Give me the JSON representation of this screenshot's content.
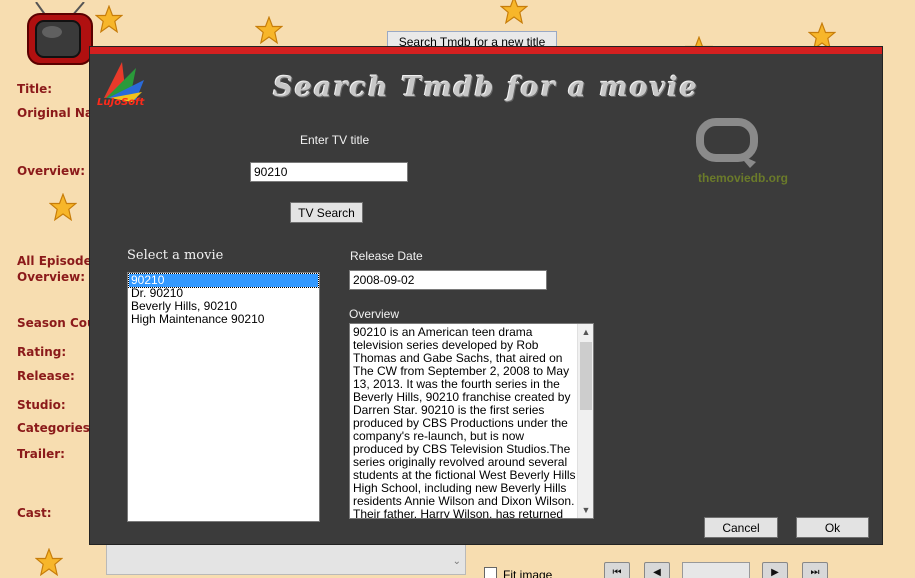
{
  "background_app": {
    "top_button_label": "Search Tmdb for a new title",
    "labels": {
      "title": "Title:",
      "original_name": "Original Nam",
      "overview": "Overview:",
      "all_episodes": "All Episodes",
      "all_episodes_overview": "Overview:",
      "season_count": "Season Count",
      "rating": "Rating:",
      "release": "Release:",
      "studio": "Studio:",
      "categories": "Categories:",
      "trailer": "Trailer:",
      "cast": "Cast:"
    },
    "fit_image_label": "Fit image",
    "label_color": "#8b1a1a",
    "bg_color": "#f7ddb0"
  },
  "dialog": {
    "title": "Search Tmdb for a movie",
    "logo_text": "LuJoSoft",
    "tmdb_logo_text": "themoviedb.org",
    "enter_title_label": "Enter TV title",
    "search_value": "90210",
    "search_button": "TV Search",
    "select_label": "Select a movie",
    "movies": [
      "90210",
      "Dr. 90210",
      "Beverly Hills, 90210",
      "High Maintenance 90210"
    ],
    "selected_index": 0,
    "release_label": "Release Date",
    "release_value": "2008-09-02",
    "overview_label": "Overview",
    "overview_text": "90210 is an American teen drama television series developed by Rob Thomas and Gabe Sachs, that aired on The CW from September 2, 2008 to May 13, 2013. It was the fourth series in the Beverly Hills, 90210 franchise created by Darren Star. 90210 is the first series produced by CBS Productions under the company's re-launch, but is now produced by CBS Television Studios.The series originally revolved around several students at the fictional West Beverly Hills High School, including new Beverly Hills residents Annie Wilson and Dixon Wilson. Their father, Harry Wilson, has returned from Kansas to his",
    "cancel_button": "Cancel",
    "ok_button": "Ok",
    "accent_color": "#d42020",
    "bg_color": "#3b3b3b"
  }
}
